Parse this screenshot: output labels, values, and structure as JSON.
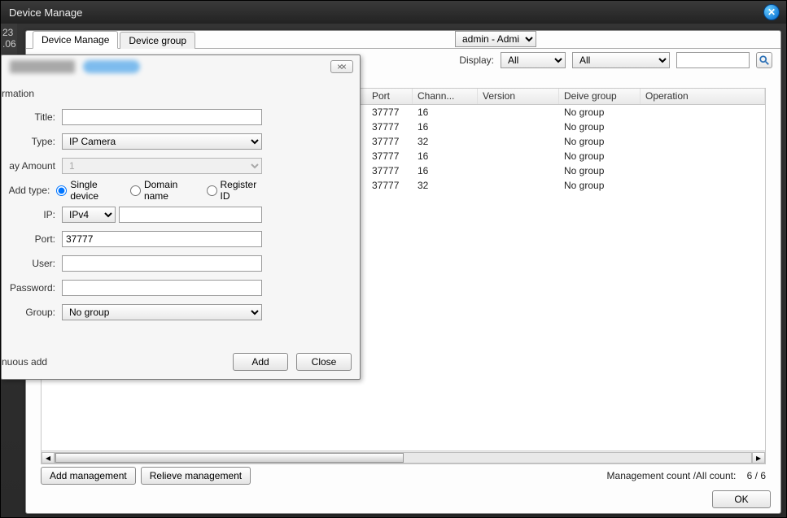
{
  "window": {
    "title": "Device Manage"
  },
  "left_strip": {
    "line1": "23",
    "line2": ".06"
  },
  "tabs": [
    {
      "label": "Device Manage",
      "active": true
    },
    {
      "label": "Device group",
      "active": false
    }
  ],
  "user_selector": {
    "value": "admin - Admin"
  },
  "filter": {
    "display_label": "Display:",
    "sel1": "All",
    "sel2": "All"
  },
  "table": {
    "headers": {
      "port": "Port",
      "chan": "Chann...",
      "version": "Version",
      "group": "Deive group",
      "op": "Operation"
    },
    "rows": [
      {
        "port": "37777",
        "chan": "16",
        "version": "",
        "group": "No group"
      },
      {
        "port": "37777",
        "chan": "16",
        "version": "",
        "group": "No group"
      },
      {
        "port": "37777",
        "chan": "32",
        "version": "",
        "group": "No group"
      },
      {
        "port": "37777",
        "chan": "16",
        "version": "",
        "group": "No group"
      },
      {
        "port": "37777",
        "chan": "16",
        "version": "",
        "group": "No group"
      },
      {
        "port": "37777",
        "chan": "32",
        "version": "",
        "group": "No group"
      }
    ]
  },
  "bottom": {
    "add_mgmt": "Add management",
    "rel_mgmt": "Relieve management",
    "count_label": "Management count /All count:",
    "count_value": "6 / 6",
    "ok": "OK"
  },
  "dialog": {
    "section": "rmation",
    "labels": {
      "title": "Title:",
      "type": "Type:",
      "amount": "ay Amount",
      "add_type": "Add type:",
      "ip": "IP:",
      "port": "Port:",
      "user": "User:",
      "password": "Password:",
      "group": "Group:"
    },
    "values": {
      "title": "",
      "type": "IP Camera",
      "amount": "1",
      "ipver": "IPv4",
      "ip": "",
      "port": "37777",
      "user": "",
      "password": "",
      "group": "No group"
    },
    "radios": {
      "single": "Single device",
      "domain": "Domain name",
      "register": "Register ID"
    },
    "cont_add": "nuous add",
    "buttons": {
      "add": "Add",
      "close": "Close"
    }
  }
}
